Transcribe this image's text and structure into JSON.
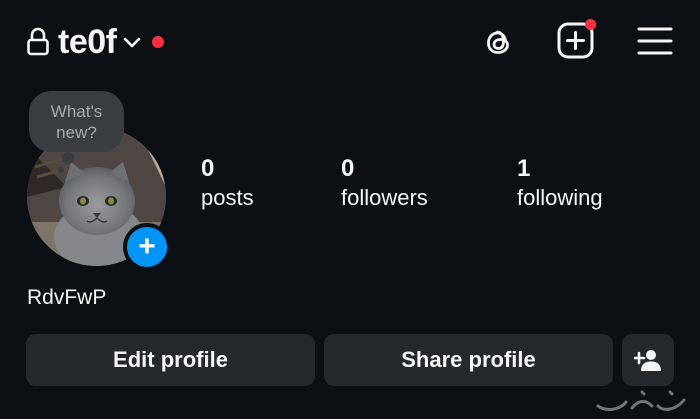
{
  "header": {
    "username": "te0f",
    "icons": [
      "lock-icon",
      "chevron-down-icon",
      "threads-icon",
      "create-post-icon",
      "menu-icon"
    ],
    "notification_color": "#ff2f40"
  },
  "note": {
    "text": "What's\nnew?"
  },
  "stats": {
    "posts": {
      "value": "0",
      "label": "posts"
    },
    "followers": {
      "value": "0",
      "label": "followers"
    },
    "following": {
      "value": "1",
      "label": "following"
    }
  },
  "profile": {
    "display_name": "RdvFwP",
    "add_story_symbol": "+"
  },
  "actions": {
    "edit_label": "Edit profile",
    "share_label": "Share profile",
    "add_person_icon": "add-person-icon"
  },
  "colors": {
    "background": "#0c1014",
    "button": "#25292e",
    "accent": "#0095f6"
  }
}
